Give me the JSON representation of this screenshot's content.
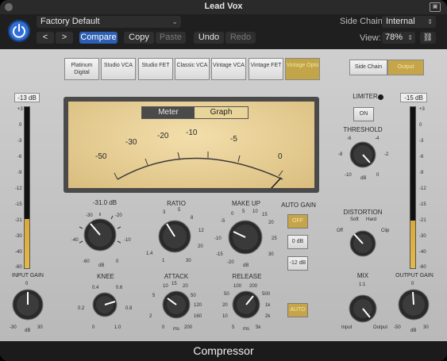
{
  "window": {
    "title": "Lead Vox"
  },
  "header": {
    "preset": "Factory Default",
    "compare_label": "Compare",
    "copy_label": "Copy",
    "paste_label": "Paste",
    "undo_label": "Undo",
    "redo_label": "Redo",
    "side_chain_label": "Side Chain:",
    "side_chain_value": "Internal",
    "view_label": "View:",
    "view_value": "78%"
  },
  "circuit_types": [
    "Platinum Digital",
    "Studio VCA",
    "Studio FET",
    "Classic VCA",
    "Vintage VCA",
    "Vintage FET",
    "Vintage Opto"
  ],
  "selected_circuit": "Vintage Opto",
  "output_toggle": {
    "side_chain": "Side Chain",
    "output": "Output"
  },
  "meter_tabs": {
    "meter": "Meter",
    "graph": "Graph",
    "active": "Meter"
  },
  "vu_scale": [
    "-50",
    "-30",
    "-20",
    "-10",
    "-5",
    "0"
  ],
  "input": {
    "readout": "-13 dB",
    "label": "INPUT GAIN",
    "scale": [
      "+3",
      "0",
      "-3",
      "-6",
      "-9",
      "-12",
      "-15",
      "-18",
      "-21",
      "-24",
      "-30",
      "-40",
      "-60"
    ],
    "knob": {
      "min": "-30",
      "max": "30",
      "center": "0",
      "unit": "dB"
    }
  },
  "output": {
    "readout": "-15 dB",
    "label": "OUTPUT GAIN",
    "scale": [
      "+3",
      "0",
      "-3",
      "-6",
      "-9",
      "-12",
      "-15",
      "-18",
      "-21",
      "-24",
      "-30",
      "-40",
      "-60"
    ],
    "knob": {
      "min": "-50",
      "max": "30",
      "center": "0",
      "unit": "dB"
    }
  },
  "threshold": {
    "value": "-31.0 dB",
    "scale": [
      "-30",
      "-20",
      "-10",
      "0",
      "-40",
      "-50",
      "-60"
    ],
    "unit": "dB"
  },
  "ratio": {
    "label": "RATIO",
    "scale": [
      "3",
      "5",
      "8",
      "12",
      "20",
      "30",
      "1.4",
      "1"
    ]
  },
  "makeup": {
    "label": "MAKE UP",
    "scale": [
      "0",
      "5",
      "10",
      "15",
      "-5",
      "20",
      "-10",
      "25",
      "-15",
      "30",
      "-20"
    ],
    "unit": "dB"
  },
  "auto_gain": {
    "label": "AUTO GAIN",
    "options": [
      "OFF",
      "0 dB",
      "-12 dB"
    ]
  },
  "knee": {
    "label": "KNEE",
    "scale": [
      "0.4",
      "0.6",
      "0.2",
      "0.8",
      "0",
      "1.0"
    ]
  },
  "attack": {
    "label": "ATTACK",
    "scale": [
      "10",
      "15",
      "20",
      "5",
      "50",
      "120",
      "2",
      "160",
      "0",
      "200"
    ],
    "unit": "ms"
  },
  "release": {
    "label": "RELEASE",
    "scale": [
      "100",
      "200",
      "50",
      "500",
      "20",
      "1k",
      "10",
      "2k",
      "5",
      "5k"
    ],
    "unit": "ms"
  },
  "release_auto": "AUTO",
  "limiter": {
    "label": "LIMITER",
    "on": "ON",
    "threshold_label": "THRESHOLD",
    "scale": [
      "-6",
      "-4",
      "-8",
      "-2",
      "-10",
      "0"
    ],
    "unit": "dB"
  },
  "distortion": {
    "label": "DISTORTION",
    "options": [
      "Off",
      "Soft",
      "Hard",
      "Clip"
    ]
  },
  "mix": {
    "label": "MIX",
    "top": "1:1",
    "min": "Input",
    "max": "Output"
  },
  "footer": {
    "title": "Compressor"
  }
}
